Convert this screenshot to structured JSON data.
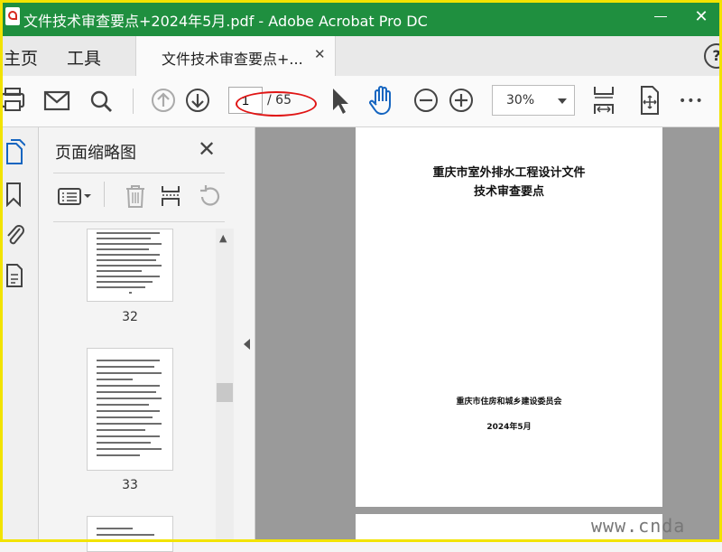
{
  "window": {
    "title": "文件技术审查要点+2024年5月.pdf - Adobe Acrobat Pro DC",
    "close_glyph": "✕"
  },
  "tabs": {
    "home": "主页",
    "tools": "工具",
    "document": "文件技术审查要点+...",
    "document_close": "✕",
    "help_glyph": "?"
  },
  "toolbar": {
    "current_page": "1",
    "total_pages": "/ 65",
    "zoom": "30%",
    "more_glyph": "•••",
    "icons": [
      "print-icon",
      "email-icon",
      "search-icon",
      "previous-page-icon",
      "next-page-icon",
      "select-cursor-icon",
      "hand-tool-icon",
      "zoom-out-icon",
      "zoom-in-icon",
      "fit-width-icon",
      "full-screen-icon",
      "more-icon"
    ]
  },
  "sidebar": {
    "panel_title": "页面缩略图",
    "close_glyph": "✕",
    "rail_icons": [
      "page-thumbnails-icon",
      "bookmark-icon",
      "attachment-icon",
      "document-properties-icon"
    ],
    "thumbnails": [
      {
        "number": "32"
      },
      {
        "number": "33"
      }
    ]
  },
  "document": {
    "title_line1": "重庆市室外排水工程设计文件",
    "title_line2": "技术审查要点",
    "issuer": "重庆市住房和城乡建设委员会",
    "date": "2024年5月"
  },
  "watermark": "www.cnda",
  "colors": {
    "title_bar": "#1f8f3f",
    "highlight_ellipse": "#e01515",
    "frame": "#f2e300",
    "hand_tool": "#1565c0"
  }
}
